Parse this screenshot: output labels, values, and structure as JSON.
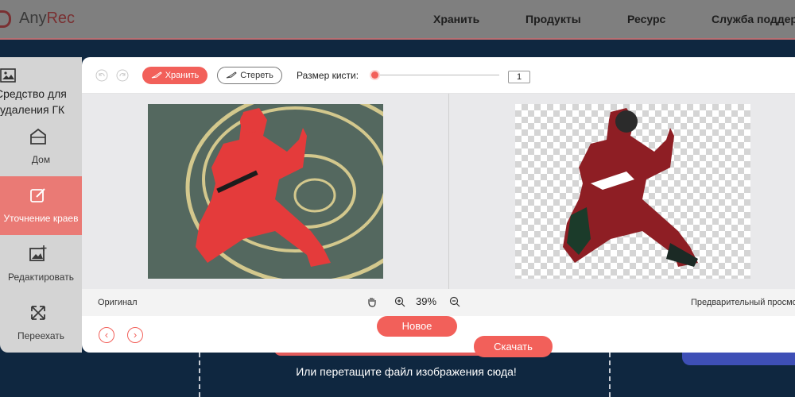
{
  "header": {
    "logo_prefix": "Any",
    "logo_suffix": "Rec",
    "nav": [
      "Хранить",
      "Продукты",
      "Ресурс",
      "Служба поддер"
    ]
  },
  "sidebar": {
    "title": "Средство для удаления ГК",
    "items": [
      {
        "label": "Дом",
        "icon": "home-icon"
      },
      {
        "label": "Уточнение краев",
        "icon": "edit-edges-icon",
        "active": true
      },
      {
        "label": "Редактировать",
        "icon": "image-edit-icon"
      },
      {
        "label": "Переехать",
        "icon": "move-icon"
      }
    ]
  },
  "toolbar": {
    "keep_label": "Хранить",
    "erase_label": "Стереть",
    "brush_size_label": "Размер кисти:",
    "brush_size_value": "1"
  },
  "status": {
    "original_label": "Оригинал",
    "zoom": "39%",
    "preview_label": "Предварительный просмотр"
  },
  "actions": {
    "new_label": "Новое",
    "download_label": "Скачать"
  },
  "page": {
    "drop_text": "Или перетащите файл изображения сюда!"
  },
  "colors": {
    "accent": "#f2605a",
    "sidebar_active": "#ea7a75",
    "page_background": "#0f2740"
  }
}
